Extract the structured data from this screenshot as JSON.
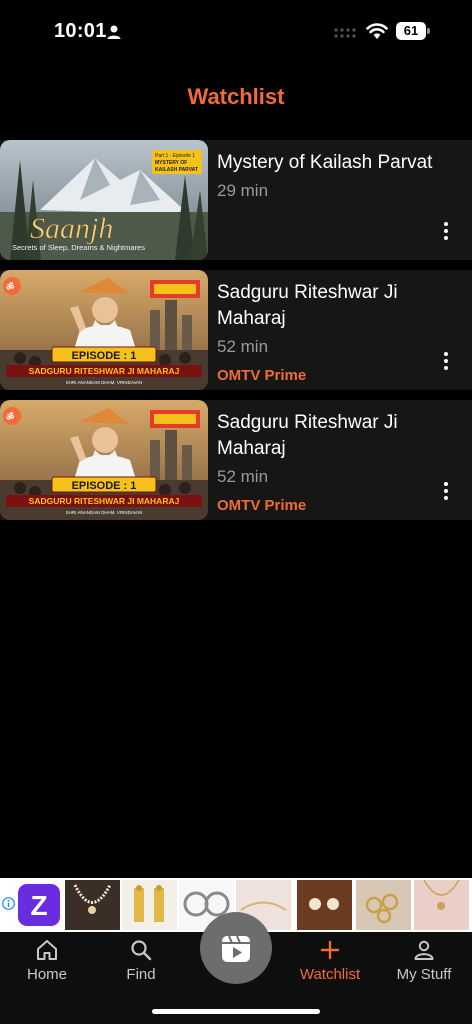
{
  "status_bar": {
    "time": "10:01",
    "battery": "61"
  },
  "page": {
    "title": "Watchlist"
  },
  "watchlist": [
    {
      "title": "Mystery of Kailash Parvat",
      "duration": "29 min",
      "channel": "",
      "thumbnail": {
        "brand": "Saanjh",
        "tagline": "Secrets of Sleep, Dreams & Nightmares",
        "badge_line1": "Part 1 - Episode 1",
        "badge_line2": "MYSTERY OF",
        "badge_line3": "KAILASH PARVAT"
      }
    },
    {
      "title": "Sadguru  Riteshwar Ji Maharaj",
      "duration": "52 min",
      "channel": "OMTV Prime",
      "thumbnail": {
        "episode": "EPISODE : 1",
        "name": "SADGURU RITESHWAR JI MAHARAJ",
        "place": "SHRI ANANDAM DHAM, VRINDAVAN"
      }
    },
    {
      "title": "Sadguru  Riteshwar Ji Maharaj",
      "duration": "52 min",
      "channel": "OMTV Prime",
      "thumbnail": {
        "episode": "EPISODE : 1",
        "name": "SADGURU RITESHWAR JI MAHARAJ",
        "place": "SHRI ANANDAM DHAM, VRINDAVAN"
      }
    }
  ],
  "ad": {
    "logo_letter": "Z",
    "products": [
      "pearl-necklace",
      "tassel-earrings",
      "hoop-earrings",
      "bracelet",
      "stud-earrings",
      "rings",
      "pendant-necklace"
    ]
  },
  "tabs": [
    {
      "label": "Home",
      "icon": "home-icon"
    },
    {
      "label": "Find",
      "icon": "search-icon"
    },
    {
      "label": "Watchlist",
      "icon": "plus-icon",
      "active": true
    },
    {
      "label": "My Stuff",
      "icon": "person-icon"
    }
  ],
  "colors": {
    "accent": "#f26b38",
    "background": "#000000",
    "card": "#161616",
    "muted": "#9a9a9a"
  }
}
